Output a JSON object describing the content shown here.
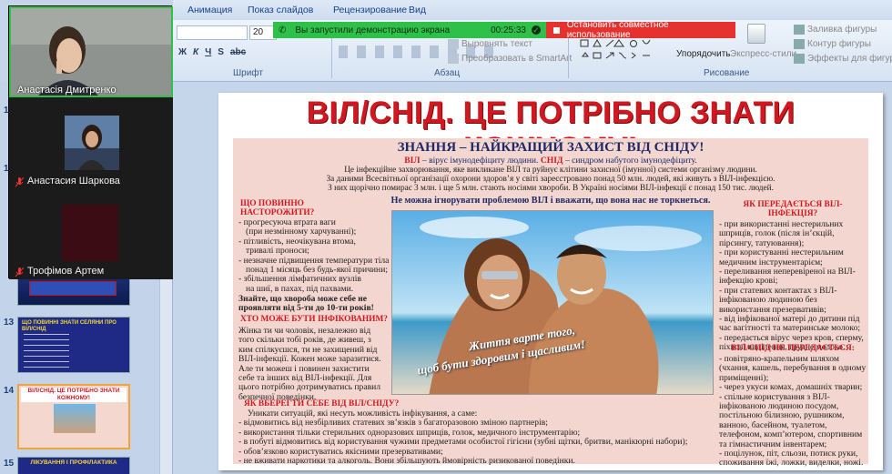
{
  "ribbon": {
    "tabs": [
      "Анимация",
      "Показ слайдов",
      "Рецензирование",
      "Вид"
    ],
    "font_size": "20",
    "groups": {
      "font": "Шрифт",
      "paragraph": "Абзац",
      "drawing": "Рисование"
    },
    "buttons": {
      "align_text": "Выровнять текст",
      "smartart": "Преобразовать в SmartArt",
      "arrange": "Упорядочить",
      "express_styles": "Экспресс-стили",
      "fill": "Заливка фигуры",
      "outline": "Контур фигуры",
      "effects": "Эффекты для фигур"
    },
    "font_buttons": [
      "Ж",
      "К",
      "Ч",
      "S",
      "abc"
    ]
  },
  "share": {
    "status": "Вы запустили демонстрацию экрана",
    "timer": "00:25:33",
    "stop": "Остановить совместное использование"
  },
  "participants": [
    {
      "name": "Анастасія Дмитренко",
      "muted": false
    },
    {
      "name": "Анастасия Шаркова",
      "muted": true
    },
    {
      "name": "Трофімов Артем",
      "muted": true
    }
  ],
  "thumbs": {
    "numbers": [
      "11",
      "12",
      "13",
      "14",
      "15"
    ],
    "t13_text": "ЩО ПОВИННІ ЗНАТИ СЕЛЯНИ ПРО ВІЛ/СНІД",
    "t14_title": "ВІЛ/СНІД. ЦЕ ПОТРІБНО ЗНАТИ КОЖНОМУ!",
    "t15_title": "ЛІКУВАННЯ І ПРОФІЛАКТИКА"
  },
  "slide": {
    "title": "ВІЛ/СНІД.  ЦЕ ПОТРІБНО ЗНАТИ КОЖНОМУ!",
    "subtitle": "ЗНАННЯ – НАЙКРАЩИЙ ЗАХИСТ ВІД СНІДУ!",
    "def_hiv_term": "ВІЛ",
    "def_hiv": " – вірус імунодефіциту людини. ",
    "def_aids_term": "СНІД",
    "def_aids": " – синдром набутого імунодефіциту.",
    "intro1": "Це інфекційне захворювання, яке викликане ВІЛ та руйнує клітини захисної (імунної) системи організму людини.",
    "intro2": "За даними Всесвітньої організації охорони здоров’я у світі зареєстровано понад 50 млн. людей, які живуть з ВІЛ-інфекцією.",
    "intro3": "З них щорічно помирає 3 млн. і ще 5 млн. стають носіями хвороби. В Україні носіями ВІЛ-інфекції є понад 150 тис. людей.",
    "warning": "Не можна ігнорувати проблемою ВІЛ і вважати, що вона нас не торкнеться.",
    "left1_title": "ЩО ПОВИННО НАСТОРОЖИТИ?",
    "left1_items": [
      "- прогресуюча втрата ваги",
      "  (при незмінному харчуванні);",
      "- пітливість, неочікувана втома,",
      "  тривалі проноси;",
      "- незначне підвищення температури тіла",
      "  понад 1 місяць без будь-якої причини;",
      "- збільшення лімфатичних вузлів",
      "  на шиї, в пахах, під пахвами."
    ],
    "left1_note": "Знайте, що хвороба може себе не проявляти від 5-ти до 10-ти років!",
    "left2_title": "ХТО МОЖЕ БУТИ ІНФІКОВАНИМ?",
    "left2_text": "Жінка ти чи чоловік, незалежно від того скільки тобі років, де живеш, з ким спілкуєшся, ти не захищений від ВІЛ-інфекції. Кожен може заразитися. Але ти можеш і повинен захистити себе та інших від ВІЛ-інфекції. Для цього потрібно дотримуватись правил безпечної поведінки.",
    "right1_title": "ЯК ПЕРЕДАЄТЬСЯ ВІЛ-ІНФЕКЦІЯ?",
    "right1_items": [
      "- при використанні нестерильних шприців, голок (після ін’єкцій, пірсингу, татуювання);",
      "- при користуванні нестерильним медичним інструментарієм;",
      "- переливання неперевіреної на ВІЛ-інфекцію крові;",
      "- при статевих контактах з ВІЛ-інфікованою людиною без використання презервативів;",
      "- від інфікованої матері до дитини під час вагітності та материнське молоко;",
      "- передається вірус через кров, сперму, піхвові виділення, грудне молоко."
    ],
    "right2_title": "ВІЛ/СНІД НЕ ПЕРЕДАЄТЬСЯ:",
    "right2_items": [
      "- повітряно-крапельним шляхом (чхання, кашель, перебування в одному приміщенні);",
      "- через укуси комах, домашніх тварин;",
      "- спільне користування з ВІЛ-інфікованою людиною посудом, постільною білизною, рушником, ванною, басейном, туалетом, телефоном, комп’ютером, спортивним та гімнастичним інвентарем;",
      "- поцілунок, піт, сльози, потиск руки, споживання їжі, ложки, виделки, ножі."
    ],
    "bottom_title": "ЯК ВБЕРЕГТИ СЕБЕ ВІД ВІЛ/СНІДУ?",
    "bottom_lines": [
      "Уникати ситуацій, які несуть можливість інфікування, а саме:",
      "- відмовитись від незбірливих статевих зв’язків з багаторазовою зміною партнерів;",
      "- використання тільки стерильних одноразових шприців, голок, медичного інструментарію;",
      "- в побуті відмовитись від користування чужими предметами особистої гігієни (зубні щітки, бритви, манікюрні набори);",
      "- обов’язково користуватись якісними презервативами;",
      "- не вживати наркотики та алкоголь. Вони збільшують ймовірність ризикованої поведінки."
    ],
    "photo_caption1": "Життя варте того,",
    "photo_caption2": "щоб бути здоровим і щасливим!"
  },
  "colors": {
    "headline": "#d11820",
    "share_green": "#2fc04a",
    "share_red": "#e5322e",
    "panel": "#f3d6cf",
    "navy": "#1d2a67"
  }
}
